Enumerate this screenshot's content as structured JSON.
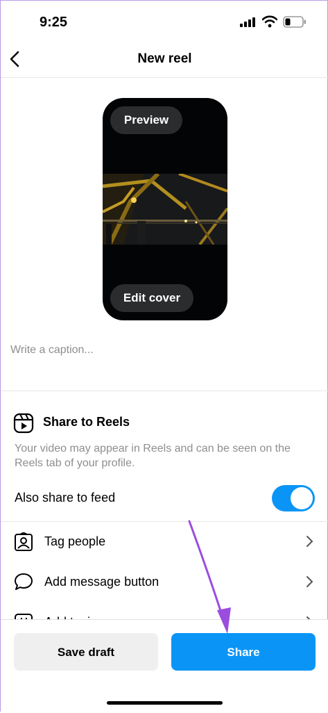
{
  "status_bar": {
    "time": "9:25"
  },
  "header": {
    "title": "New reel"
  },
  "preview": {
    "preview_label": "Preview",
    "edit_cover_label": "Edit cover"
  },
  "caption": {
    "placeholder": "Write a caption...",
    "value": ""
  },
  "reels": {
    "title": "Share to Reels",
    "description": "Your video may appear in Reels and can be seen on the Reels tab of your profile.",
    "also_share_label": "Also share to feed",
    "also_share_enabled": true
  },
  "options": [
    {
      "label": "Tag people",
      "icon": "tag-people-icon"
    },
    {
      "label": "Add message button",
      "icon": "message-bubble-icon"
    },
    {
      "label": "Add topics",
      "icon": "hashtag-icon"
    }
  ],
  "actions": {
    "save_draft_label": "Save draft",
    "share_label": "Share"
  },
  "colors": {
    "accent": "#0a95f6",
    "secondary_button": "#efefef",
    "annotation_arrow": "#9b4de0"
  }
}
